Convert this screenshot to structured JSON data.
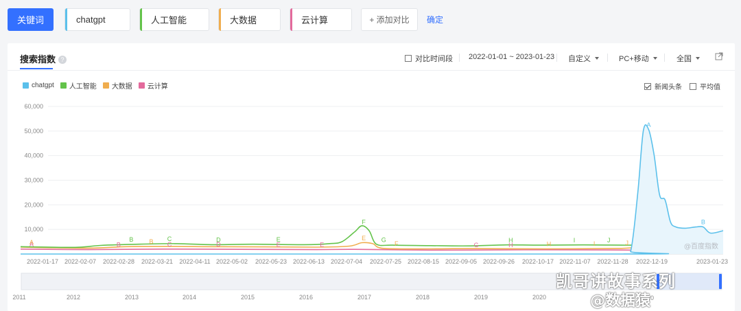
{
  "keywords_bar": {
    "label": "关键词",
    "keywords": [
      {
        "text": "chatgpt",
        "color": "#5bc0eb"
      },
      {
        "text": "人工智能",
        "color": "#63c34a"
      },
      {
        "text": "大数据",
        "color": "#f0ad4e"
      },
      {
        "text": "云计算",
        "color": "#e36a9c"
      }
    ],
    "add_label": "+ 添加对比",
    "confirm_label": "确定"
  },
  "card": {
    "tab_label": "搜索指数",
    "help_icon": "?",
    "compare_period_label": "对比时间段",
    "date_range": "2022-01-01 ~ 2023-01-23",
    "custom_label": "自定义",
    "device_label": "PC+移动",
    "region_label": "全国",
    "external_icon": "external-link-icon"
  },
  "legend": [
    {
      "name": "chatgpt",
      "color": "#5bc0eb"
    },
    {
      "name": "人工智能",
      "color": "#63c34a"
    },
    {
      "name": "大数据",
      "color": "#f0ad4e"
    },
    {
      "name": "云计算",
      "color": "#e36a9c"
    }
  ],
  "options": {
    "news_label": "新闻头条",
    "news_checked": true,
    "avg_label": "平均值",
    "avg_checked": false
  },
  "chart_data": {
    "type": "line",
    "y_ticks": [
      "60,000",
      "50,000",
      "40,000",
      "30,000",
      "20,000",
      "10,000"
    ],
    "ylim": [
      0,
      60000
    ],
    "x_tick_labels": [
      "2022-01-17",
      "2022-02-07",
      "2022-02-28",
      "2022-03-21",
      "2022-04-11",
      "2022-05-02",
      "2022-05-23",
      "2022-06-13",
      "2022-07-04",
      "2022-07-25",
      "2022-08-15",
      "2022-09-05",
      "2022-09-26",
      "2022-10-17",
      "2022-11-07",
      "2022-11-28",
      "2022-12-19",
      "2023-01-23"
    ],
    "x_range": [
      "2022-01-01",
      "2023-01-23"
    ],
    "series": [
      {
        "name": "chatgpt",
        "color": "#5bc0eb",
        "values": [
          [
            "2022-01-01",
            0
          ],
          [
            "2022-11-28",
            0
          ],
          [
            "2022-12-03",
            1000
          ],
          [
            "2022-12-07",
            25000
          ],
          [
            "2022-12-10",
            50000
          ],
          [
            "2022-12-13",
            50500
          ],
          [
            "2022-12-16",
            40000
          ],
          [
            "2022-12-19",
            24000
          ],
          [
            "2022-12-22",
            22000
          ],
          [
            "2022-12-25",
            13000
          ],
          [
            "2022-12-28",
            11000
          ],
          [
            "2023-01-02",
            10500
          ],
          [
            "2023-01-08",
            11000
          ],
          [
            "2023-01-12",
            11000
          ],
          [
            "2023-01-16",
            8500
          ],
          [
            "2023-01-23",
            9500
          ]
        ]
      },
      {
        "name": "人工智能",
        "color": "#63c34a",
        "values": [
          [
            "2022-01-01",
            3000
          ],
          [
            "2022-01-31",
            2700
          ],
          [
            "2022-02-14",
            3500
          ],
          [
            "2022-03-07",
            4000
          ],
          [
            "2022-03-28",
            4200
          ],
          [
            "2022-04-18",
            3800
          ],
          [
            "2022-05-09",
            4000
          ],
          [
            "2022-06-06",
            3800
          ],
          [
            "2022-06-20",
            4200
          ],
          [
            "2022-06-27",
            5000
          ],
          [
            "2022-07-04",
            9000
          ],
          [
            "2022-07-08",
            11500
          ],
          [
            "2022-07-12",
            9500
          ],
          [
            "2022-07-16",
            4000
          ],
          [
            "2022-07-25",
            3600
          ],
          [
            "2022-08-15",
            3400
          ],
          [
            "2022-09-05",
            3300
          ],
          [
            "2022-09-26",
            3700
          ],
          [
            "2022-10-17",
            3600
          ],
          [
            "2022-11-07",
            3700
          ],
          [
            "2022-11-28",
            3600
          ],
          [
            "2022-12-19",
            3500
          ],
          [
            "2023-01-09",
            2500
          ],
          [
            "2023-01-23",
            2200
          ]
        ]
      },
      {
        "name": "大数据",
        "color": "#f0ad4e",
        "values": [
          [
            "2022-01-01",
            2800
          ],
          [
            "2022-02-07",
            2400
          ],
          [
            "2022-02-28",
            3000
          ],
          [
            "2022-03-21",
            3100
          ],
          [
            "2022-04-11",
            3000
          ],
          [
            "2022-05-16",
            2900
          ],
          [
            "2022-06-13",
            2800
          ],
          [
            "2022-07-01",
            3200
          ],
          [
            "2022-07-08",
            4600
          ],
          [
            "2022-07-14",
            4200
          ],
          [
            "2022-07-20",
            2300
          ],
          [
            "2022-08-15",
            2100
          ],
          [
            "2022-09-05",
            2200
          ],
          [
            "2022-10-17",
            2100
          ],
          [
            "2022-11-28",
            2300
          ],
          [
            "2022-12-10",
            3000
          ],
          [
            "2022-12-19",
            2200
          ],
          [
            "2023-01-23",
            1500
          ]
        ]
      },
      {
        "name": "云计算",
        "color": "#e36a9c",
        "values": [
          [
            "2022-01-01",
            2000
          ],
          [
            "2022-02-07",
            1800
          ],
          [
            "2022-03-21",
            2000
          ],
          [
            "2022-05-02",
            1900
          ],
          [
            "2022-06-13",
            1800
          ],
          [
            "2022-07-04",
            1900
          ],
          [
            "2022-08-15",
            1600
          ],
          [
            "2022-09-26",
            1700
          ],
          [
            "2022-11-07",
            1700
          ],
          [
            "2022-12-19",
            1500
          ],
          [
            "2023-01-23",
            1100
          ]
        ]
      }
    ],
    "annotations": [
      {
        "label": "A",
        "date": "2022-01-01",
        "series": "云计算"
      },
      {
        "label": "A",
        "date": "2022-01-01",
        "series": "大数据"
      },
      {
        "label": "B",
        "date": "2022-02-24",
        "series": "云计算"
      },
      {
        "label": "B",
        "date": "2022-03-03",
        "series": "人工智能"
      },
      {
        "label": "B",
        "date": "2022-03-14",
        "series": "大数据"
      },
      {
        "label": "C",
        "date": "2022-03-24",
        "series": "人工智能"
      },
      {
        "label": "C",
        "date": "2022-03-24",
        "series": "云计算"
      },
      {
        "label": "D",
        "date": "2022-04-20",
        "series": "人工智能"
      },
      {
        "label": "D",
        "date": "2022-04-20",
        "series": "云计算"
      },
      {
        "label": "E",
        "date": "2022-05-23",
        "series": "人工智能"
      },
      {
        "label": "E",
        "date": "2022-05-23",
        "series": "云计算"
      },
      {
        "label": "E",
        "date": "2022-07-09",
        "series": "大数据"
      },
      {
        "label": "E",
        "date": "2022-06-16",
        "series": "云计算"
      },
      {
        "label": "F",
        "date": "2022-07-09",
        "series": "人工智能"
      },
      {
        "label": "F",
        "date": "2022-07-27",
        "series": "大数据"
      },
      {
        "label": "G",
        "date": "2022-07-20",
        "series": "人工智能"
      },
      {
        "label": "G",
        "date": "2022-09-09",
        "series": "云计算"
      },
      {
        "label": "H",
        "date": "2022-09-28",
        "series": "人工智能"
      },
      {
        "label": "H",
        "date": "2022-09-28",
        "series": "云计算"
      },
      {
        "label": "H",
        "date": "2022-10-19",
        "series": "大数据"
      },
      {
        "label": "I",
        "date": "2022-11-02",
        "series": "人工智能"
      },
      {
        "label": "I",
        "date": "2022-11-13",
        "series": "大数据"
      },
      {
        "label": "J",
        "date": "2022-11-21",
        "series": "人工智能"
      },
      {
        "label": "J",
        "date": "2022-12-01",
        "series": "大数据"
      },
      {
        "label": "A",
        "date": "2022-12-13",
        "series": "chatgpt"
      },
      {
        "label": "B",
        "date": "2023-01-12",
        "series": "chatgpt"
      }
    ],
    "watermark_text": "@百度指数",
    "overview": {
      "year_labels": [
        "2011",
        "2012",
        "2013",
        "2014",
        "2015",
        "2016",
        "2017",
        "2018",
        "2019",
        "2020"
      ],
      "partial_label": "20"
    }
  },
  "overlay_watermark": {
    "line1": "凯哥讲故事系列",
    "line2": "@数据猿"
  }
}
